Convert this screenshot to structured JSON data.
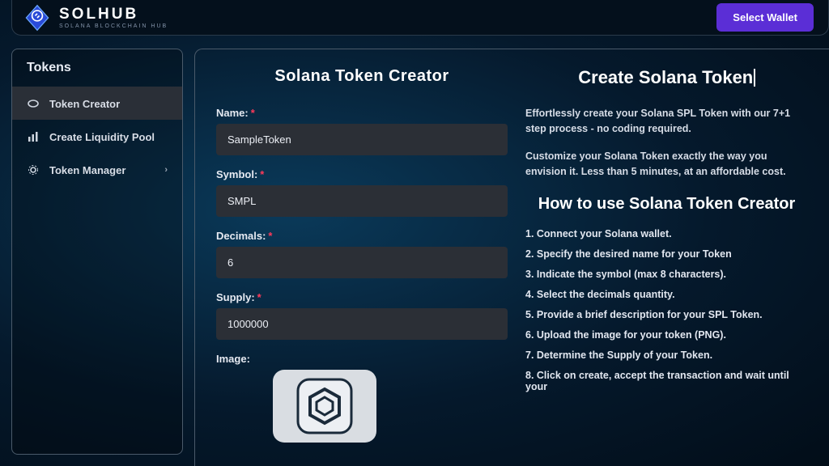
{
  "brand": {
    "name": "SOLHUB",
    "subtitle": "SOLANA BLOCKCHAIN HUB"
  },
  "header": {
    "select_wallet": "Select Wallet"
  },
  "sidebar": {
    "heading": "Tokens",
    "items": [
      {
        "label": "Token Creator",
        "icon": "coin"
      },
      {
        "label": "Create Liquidity Pool",
        "icon": "chart"
      },
      {
        "label": "Token Manager",
        "icon": "gear",
        "chevron": true
      }
    ]
  },
  "form": {
    "title": "Solana Token Creator",
    "fields": {
      "name": {
        "label": "Name:",
        "value": "SampleToken",
        "required": true
      },
      "symbol": {
        "label": "Symbol:",
        "value": "SMPL",
        "required": true
      },
      "decimals": {
        "label": "Decimals:",
        "value": "6",
        "required": true
      },
      "supply": {
        "label": "Supply:",
        "value": "1000000",
        "required": true
      },
      "image": {
        "label": "Image:"
      }
    }
  },
  "info": {
    "title": "Create Solana Token",
    "paragraphs": [
      "Effortlessly create your Solana SPL Token with our 7+1 step process - no coding required.",
      "Customize your Solana Token exactly the way you envision it. Less than 5 minutes, at an affordable cost."
    ],
    "howto_title": "How to use Solana Token Creator",
    "steps": [
      "1. Connect your Solana wallet.",
      "2. Specify the desired name for your Token",
      "3. Indicate the symbol (max 8 characters).",
      "4. Select the decimals quantity.",
      "5. Provide a brief description for your SPL Token.",
      "6. Upload the image for your token (PNG).",
      "7. Determine the Supply of your Token.",
      "8. Click on create, accept the transaction and wait until your"
    ]
  },
  "required_mark": "*"
}
